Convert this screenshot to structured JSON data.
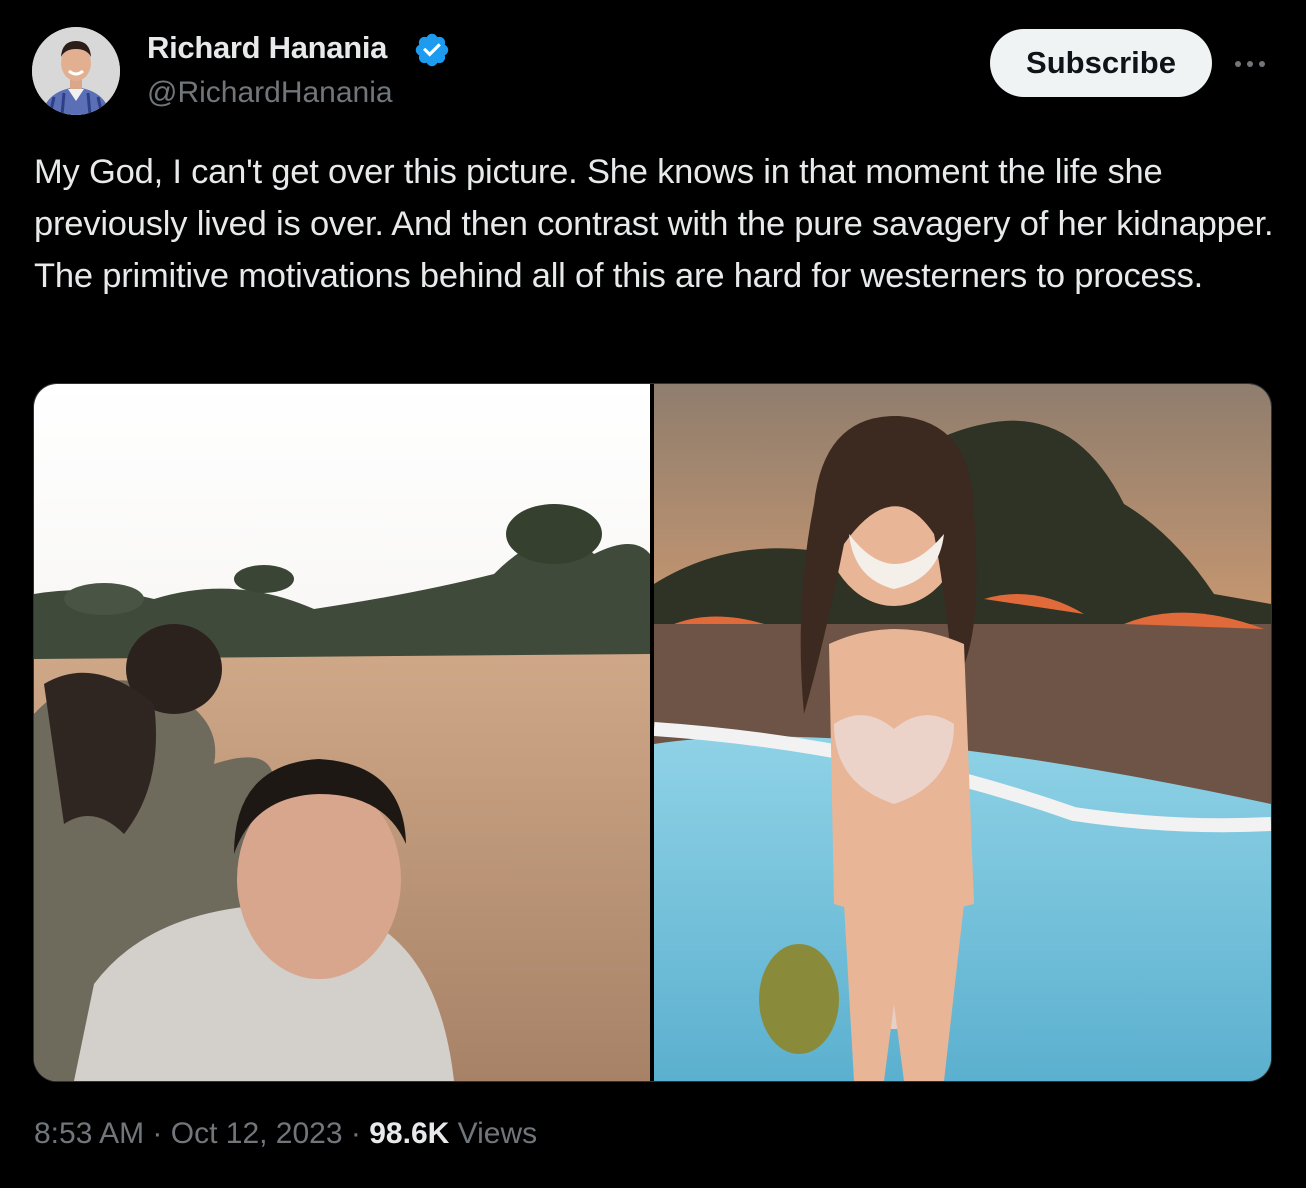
{
  "author": {
    "name": "Richard Hanania",
    "handle": "@RichardHanania",
    "verified": true,
    "verified_icon": "verified-badge-icon",
    "verified_color": "#1d9bf0"
  },
  "actions": {
    "subscribe_label": "Subscribe",
    "more_icon": "more-horizontal-icon"
  },
  "tweet": {
    "text": "My God, I can't get over this picture. She knows in that moment the life she previously lived is over. And then contrast with the pure savagery of her kidnapper. The primitive motivations behind all of this are hard for westerners to process.",
    "media_count": 2
  },
  "meta": {
    "time": "8:53 AM",
    "separator": "·",
    "date": "Oct 12, 2023",
    "views_count": "98.6K",
    "views_label": "Views"
  },
  "colors": {
    "background": "#000000",
    "text_primary": "#e7e9ea",
    "text_secondary": "#71767b",
    "button_bg": "#eff3f4",
    "button_text": "#0f1419"
  }
}
